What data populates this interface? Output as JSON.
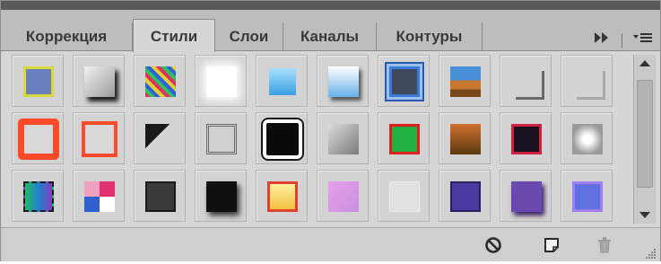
{
  "tabs": [
    {
      "label": "Коррекция",
      "active": false
    },
    {
      "label": "Стили",
      "active": true
    },
    {
      "label": "Слои",
      "active": false
    },
    {
      "label": "Каналы",
      "active": false
    },
    {
      "label": "Контуры",
      "active": false
    }
  ],
  "tab_menu": {
    "expand_icon": "double-chevron-right-icon",
    "menu_icon": "panel-menu-icon"
  },
  "style_swatches": [
    [
      "blue-yellow-outline-style",
      "gray-drop-shadow-style",
      "multicolor-pattern-style",
      "white-glow-style",
      "light-blue-gradient-style",
      "sky-gradient-style",
      "blue-double-frame-style",
      "landscape-gradient-style",
      "gray-corner-shadow-style",
      "gray-corner-light-style"
    ],
    [
      "red-thick-stroke-style",
      "red-thin-stroke-style",
      "black-corner-style",
      "gray-inset-frame-style",
      "black-white-stroke-style",
      "gray-bevel-style",
      "green-red-frame-style",
      "brown-texture-style",
      "red-black-frame-style",
      "sparkle-texture-style"
    ],
    [
      "rainbow-dashed-style",
      "pinwheel-pattern-style",
      "dark-gray-style",
      "black-shadow-style",
      "yellow-red-frame-style",
      "lilac-pastel-style",
      "white-faint-style",
      "purple-blue-frame-style",
      "purple-shadow-style",
      "blue-purple-frame-style"
    ]
  ],
  "bottom_bar": {
    "clear_icon": "clear-style-icon",
    "new_icon": "new-style-icon",
    "delete_icon": "trash-icon"
  },
  "colors": {
    "panel_bg": "#d6d6d6",
    "tab_bar_bg": "#bdbdbd",
    "accent_red": "#e8432a"
  }
}
